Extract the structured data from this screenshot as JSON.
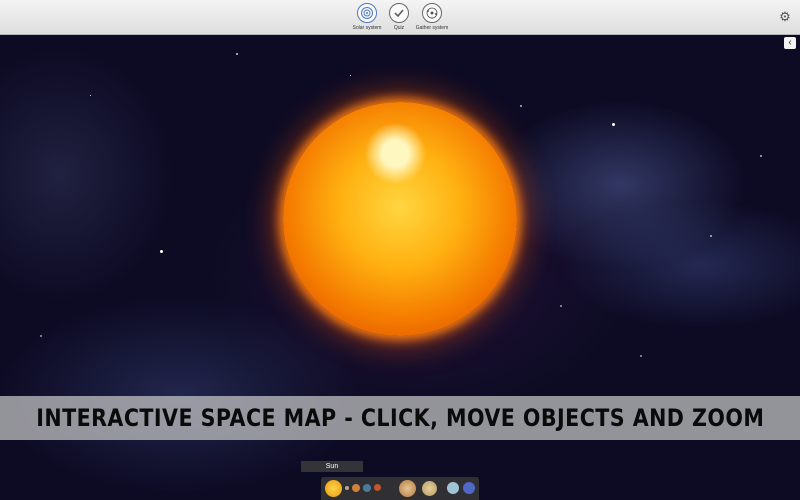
{
  "toolbar": {
    "items": [
      {
        "label": "Solar system",
        "icon": "solar-system-icon"
      },
      {
        "label": "Quiz",
        "icon": "checkmark-icon"
      },
      {
        "label": "Gather system",
        "icon": "gather-system-icon"
      }
    ],
    "settings_icon": "gear-icon"
  },
  "collapse_icon": "chevron-left-icon",
  "banner": {
    "text": "INTERACTIVE SPACE MAP - CLICK, MOVE OBJECTS AND ZOOM"
  },
  "selected_object": {
    "label": "Sun"
  },
  "planet_bar": {
    "items": [
      "sun",
      "mercury",
      "venus",
      "earth",
      "mars",
      "jupiter",
      "saturn",
      "uranus",
      "neptune"
    ]
  },
  "colors": {
    "sun": "#ffb010",
    "toolbar": "#e8e8e8",
    "banner": "#c8c8c8"
  }
}
